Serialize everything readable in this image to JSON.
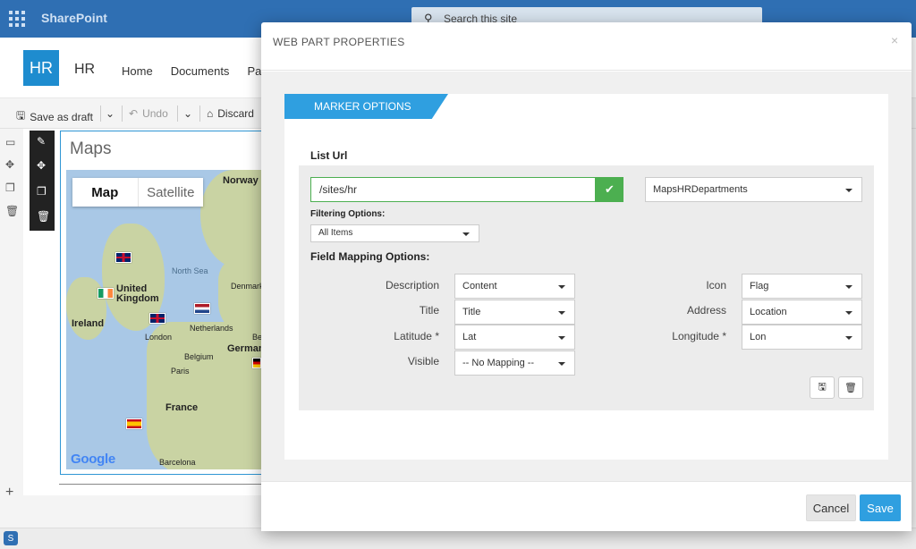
{
  "sharepoint": {
    "brand": "SharePoint",
    "search_placeholder": "Search this site",
    "site_logo": "HR",
    "site_name": "HR",
    "nav": [
      "Home",
      "Documents",
      "Pag"
    ],
    "command_bar": {
      "save_draft": "Save as draft",
      "undo": "Undo",
      "discard": "Discard"
    }
  },
  "map_webpart": {
    "title": "Maps",
    "toggle": {
      "map": "Map",
      "satellite": "Satellite"
    },
    "labels": {
      "norway": "Norway",
      "north_sea": "North Sea",
      "united_kingdom": "United\nKingdom",
      "denmark": "Denmark",
      "ireland": "Ireland",
      "london": "London",
      "netherlands": "Netherlands",
      "belgium": "Belgium",
      "germany": "German",
      "paris": "Paris",
      "france": "France",
      "barcelona": "Barcelona",
      "be": "Be"
    },
    "google": "Google",
    "flags": [
      "uk",
      "ie",
      "uk",
      "nl",
      "de",
      "es"
    ]
  },
  "modal": {
    "title": "WEB PART PROPERTIES",
    "close_icon": "×",
    "tab": "MARKER OPTIONS",
    "list_url_label": "List Url",
    "list_url_value": "/sites/hr",
    "list_select": "MapsHRDepartments",
    "filtering_label": "Filtering Options:",
    "filtering_value": "All Items",
    "field_mapping_label": "Field Mapping Options:",
    "fields_left": [
      {
        "label": "Description",
        "value": "Content"
      },
      {
        "label": "Title",
        "value": "Title"
      },
      {
        "label": "Latitude *",
        "value": "Lat"
      },
      {
        "label": "Visible",
        "value": "-- No Mapping --"
      }
    ],
    "fields_right": [
      {
        "label": "Icon",
        "value": "Flag"
      },
      {
        "label": "Address",
        "value": "Location"
      },
      {
        "label": "Longitude *",
        "value": "Lon"
      }
    ],
    "cancel": "Cancel",
    "save": "Save"
  },
  "colors": {
    "accent": "#2f9fe0",
    "success": "#4caf50",
    "suite_bar": "#2f6fb3"
  }
}
